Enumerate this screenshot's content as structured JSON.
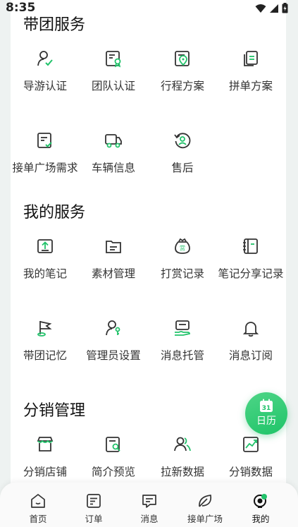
{
  "status_bar": {
    "time": "8:35"
  },
  "sections": {
    "tour": {
      "title": "带团服务",
      "items": [
        {
          "label": "导游认证",
          "icon": "guide-cert-icon"
        },
        {
          "label": "团队认证",
          "icon": "team-cert-icon"
        },
        {
          "label": "行程方案",
          "icon": "itinerary-icon"
        },
        {
          "label": "拼单方案",
          "icon": "group-order-icon"
        },
        {
          "label": "接单广场需求",
          "icon": "order-square-demand-icon"
        },
        {
          "label": "车辆信息",
          "icon": "vehicle-icon"
        },
        {
          "label": "售后",
          "icon": "after-sales-icon"
        }
      ]
    },
    "my": {
      "title": "我的服务",
      "items": [
        {
          "label": "我的笔记",
          "icon": "upload-note-icon"
        },
        {
          "label": "素材管理",
          "icon": "folder-icon"
        },
        {
          "label": "打赏记录",
          "icon": "reward-icon"
        },
        {
          "label": "笔记分享记录",
          "icon": "notebook-icon"
        },
        {
          "label": "带团记忆",
          "icon": "flag-icon"
        },
        {
          "label": "管理员设置",
          "icon": "admin-icon"
        },
        {
          "label": "消息托管",
          "icon": "message-hosting-icon"
        },
        {
          "label": "消息订阅",
          "icon": "bell-icon"
        }
      ]
    },
    "dist": {
      "title": "分销管理",
      "items": [
        {
          "label": "分销店铺",
          "icon": "shop-icon"
        },
        {
          "label": "简介预览",
          "icon": "preview-icon"
        },
        {
          "label": "拉新数据",
          "icon": "users-icon"
        },
        {
          "label": "分销数据",
          "icon": "chart-icon"
        }
      ]
    }
  },
  "fab": {
    "day": "31",
    "label": "日历"
  },
  "tabs": [
    {
      "label": "首页",
      "icon": "home-icon"
    },
    {
      "label": "订单",
      "icon": "order-icon"
    },
    {
      "label": "消息",
      "icon": "message-icon"
    },
    {
      "label": "接单广场",
      "icon": "leaf-icon"
    },
    {
      "label": "我的",
      "icon": "profile-icon",
      "active": true
    }
  ],
  "colors": {
    "accent": "#21c26a",
    "text": "#333333",
    "background": "#eef2f1"
  }
}
